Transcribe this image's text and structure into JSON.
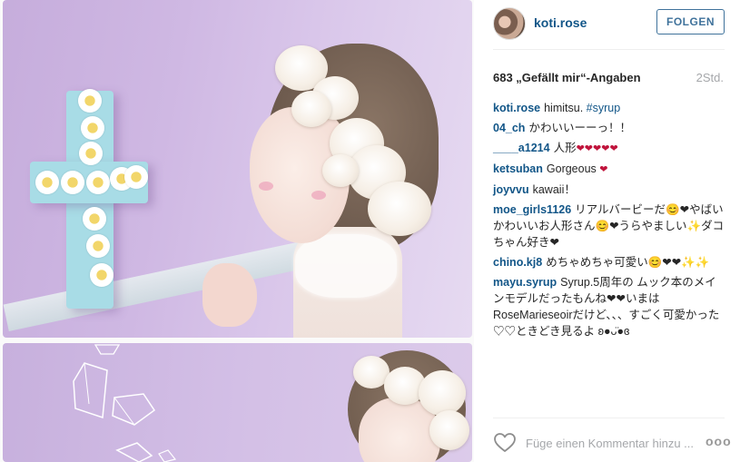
{
  "post": {
    "author": "koti.rose",
    "follow_label": "FOLGEN",
    "likes_label": "683 „Gefällt mir“-Angaben",
    "time_ago": "2Std."
  },
  "comments": [
    {
      "user": "koti.rose",
      "text": "himitsu.",
      "tag": "#syrup"
    },
    {
      "user": "04_ch",
      "text": "かわいいーーっ！！"
    },
    {
      "user": "____a1214",
      "text": "人形",
      "hearts": "❤❤❤❤❤"
    },
    {
      "user": "ketsuban",
      "text": "Gorgeous",
      "hearts": "❤"
    },
    {
      "user": "joyvvu",
      "text": "kawaii！"
    },
    {
      "user": "moe_girls1126",
      "text": "リアルバービーだ😊❤やばいかわいいお人形さん😊❤うらやましい✨ダコちゃん好き❤"
    },
    {
      "user": "chino.kj8",
      "text": "めちゃめちゃ可愛い😊❤❤✨✨"
    },
    {
      "user": "mayu.syrup",
      "text": "Syrup.5周年の ムック本のメインモデルだったもんね❤❤いまは RoseMarieseoirだけど、、、すごく可愛かった♡♡ときどき見るよ ʚ●ᴗ̈●ɞ"
    }
  ],
  "footer": {
    "comment_placeholder": "Füge einen Kommentar hinzu ...",
    "more_label": "ooo"
  },
  "icons": {
    "like": "heart-outline-icon",
    "more": "more-options-icon"
  },
  "colors": {
    "link": "#125688",
    "follow": "#3f729b",
    "muted": "#a5a7aa"
  }
}
